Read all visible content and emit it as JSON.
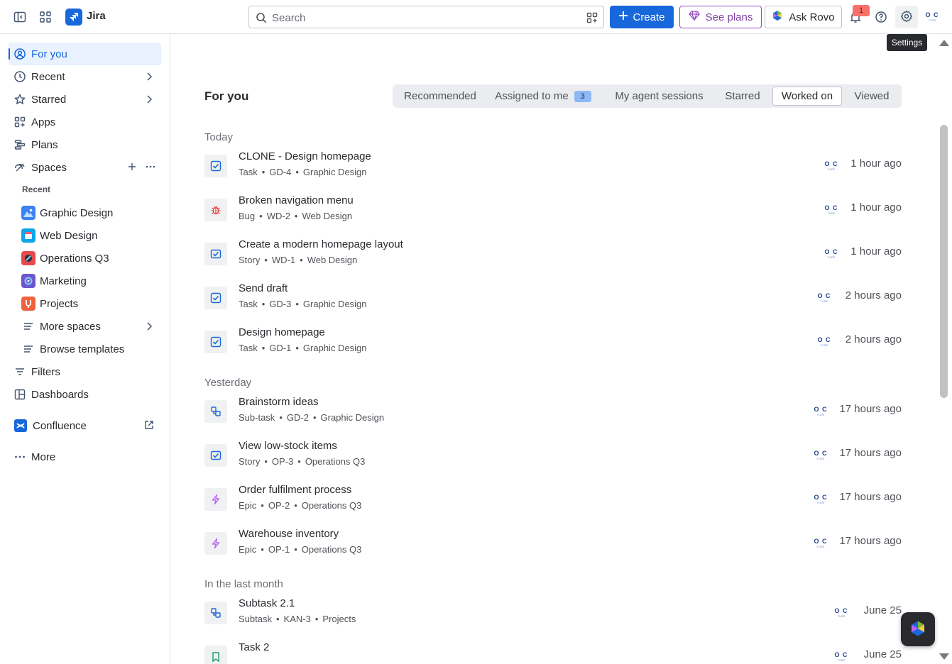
{
  "topbar": {
    "app_name": "Jira",
    "search_placeholder": "Search",
    "create_label": "Create",
    "see_plans_label": "See plans",
    "ask_rovo_label": "Ask Rovo",
    "notification_count": "1",
    "settings_tooltip": "Settings"
  },
  "sidebar": {
    "for_you": "For you",
    "recent": "Recent",
    "starred": "Starred",
    "apps": "Apps",
    "plans": "Plans",
    "spaces": "Spaces",
    "spaces_recent_label": "Recent",
    "spaces_list": [
      {
        "label": "Graphic Design",
        "color": "#3b82f6"
      },
      {
        "label": "Web Design",
        "color": "#0ea5e9"
      },
      {
        "label": "Operations Q3",
        "color": "#e5484d"
      },
      {
        "label": "Marketing",
        "color": "#6e56cf"
      },
      {
        "label": "Projects",
        "color": "#f2613f"
      }
    ],
    "more_spaces": "More spaces",
    "browse_templates": "Browse templates",
    "filters": "Filters",
    "dashboards": "Dashboards",
    "confluence": "Confluence",
    "more": "More"
  },
  "main": {
    "title": "For you",
    "tabs": [
      {
        "label": "Recommended"
      },
      {
        "label": "Assigned to me",
        "count": "3"
      },
      {
        "label": "My agent sessions"
      },
      {
        "label": "Starred"
      },
      {
        "label": "Worked on",
        "selected": true
      },
      {
        "label": "Viewed"
      }
    ],
    "groups": [
      {
        "label": "Today"
      },
      {
        "label": "Yesterday"
      },
      {
        "label": "In the last month"
      }
    ],
    "avatar_text": "O C",
    "avatar_sub": "TURE",
    "items": [
      {
        "title": "CLONE - Design homepage",
        "type": "Task",
        "key": "GD-4",
        "space": "Graphic Design",
        "time": "1 hour ago",
        "icon": "task-icon"
      },
      {
        "title": "Broken navigation menu",
        "type": "Bug",
        "key": "WD-2",
        "space": "Web Design",
        "time": "1 hour ago",
        "icon": "bug-icon"
      },
      {
        "title": "Create a modern homepage layout",
        "type": "Story",
        "key": "WD-1",
        "space": "Web Design",
        "time": "1 hour ago",
        "icon": "story-icon"
      },
      {
        "title": "Send draft",
        "type": "Task",
        "key": "GD-3",
        "space": "Graphic Design",
        "time": "2 hours ago",
        "icon": "task-icon"
      },
      {
        "title": "Design homepage",
        "type": "Task",
        "key": "GD-1",
        "space": "Graphic Design",
        "time": "2 hours ago",
        "icon": "task-icon"
      },
      {
        "title": "Brainstorm ideas",
        "type": "Sub-task",
        "key": "GD-2",
        "space": "Graphic Design",
        "time": "17 hours ago",
        "icon": "subtask-icon"
      },
      {
        "title": "View low-stock items",
        "type": "Story",
        "key": "OP-3",
        "space": "Operations Q3",
        "time": "17 hours ago",
        "icon": "story-icon"
      },
      {
        "title": "Order fulfilment process",
        "type": "Epic",
        "key": "OP-2",
        "space": "Operations Q3",
        "time": "17 hours ago",
        "icon": "epic-icon"
      },
      {
        "title": "Warehouse inventory",
        "type": "Epic",
        "key": "OP-1",
        "space": "Operations Q3",
        "time": "17 hours ago",
        "icon": "epic-icon"
      },
      {
        "title": "Subtask 2.1",
        "type": "Subtask",
        "key": "KAN-3",
        "space": "Projects",
        "time": "June 25",
        "icon": "subtask-icon"
      },
      {
        "title": "Task 2",
        "type": "",
        "key": "",
        "space": "",
        "time": "June 25",
        "icon": "bookmark-icon"
      }
    ]
  },
  "colors": {
    "accent": "#1868db",
    "plans_purple": "#964ac0",
    "active_bg": "#e9f2fe"
  }
}
